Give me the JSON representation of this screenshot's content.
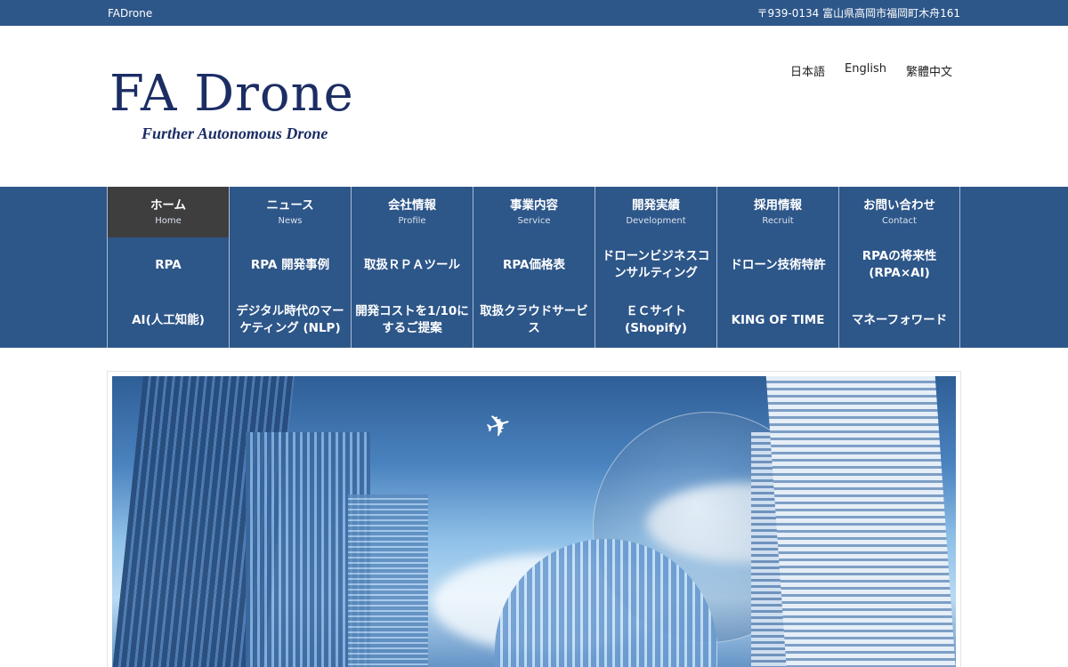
{
  "topbar": {
    "site_name": "FADrone",
    "address": "〒939-0134 富山県高岡市福岡町木舟161"
  },
  "logo": {
    "title": "FA Drone",
    "subtitle": "Further Autonomous Drone"
  },
  "languages": [
    "日本語",
    "English",
    "繁體中文"
  ],
  "nav": {
    "row1": [
      {
        "label": "ホーム",
        "en": "Home",
        "active": true
      },
      {
        "label": "ニュース",
        "en": "News"
      },
      {
        "label": "会社情報",
        "en": "Profile"
      },
      {
        "label": "事業内容",
        "en": "Service"
      },
      {
        "label": "開発実績",
        "en": "Development"
      },
      {
        "label": "採用情報",
        "en": "Recruit"
      },
      {
        "label": "お問い合わせ",
        "en": "Contact"
      }
    ],
    "row2": [
      "RPA",
      "RPA 開発事例",
      "取扱ＲＰＡツール",
      "RPA価格表",
      "ドローンビジネスコンサルティング",
      "ドローン技術特許",
      "RPAの将来性(RPA×AI)"
    ],
    "row3": [
      "AI(人工知能)",
      "デジタル時代のマーケティング (NLP)",
      "開発コストを1/10にするご提案",
      "取扱クラウドサービス",
      "ＥＣサイト(Shopify)",
      "KING OF TIME",
      "マネーフォワード"
    ]
  },
  "colors": {
    "brand": "#2d5689",
    "active_nav": "#3e3e3e",
    "logo": "#1c2d64"
  }
}
